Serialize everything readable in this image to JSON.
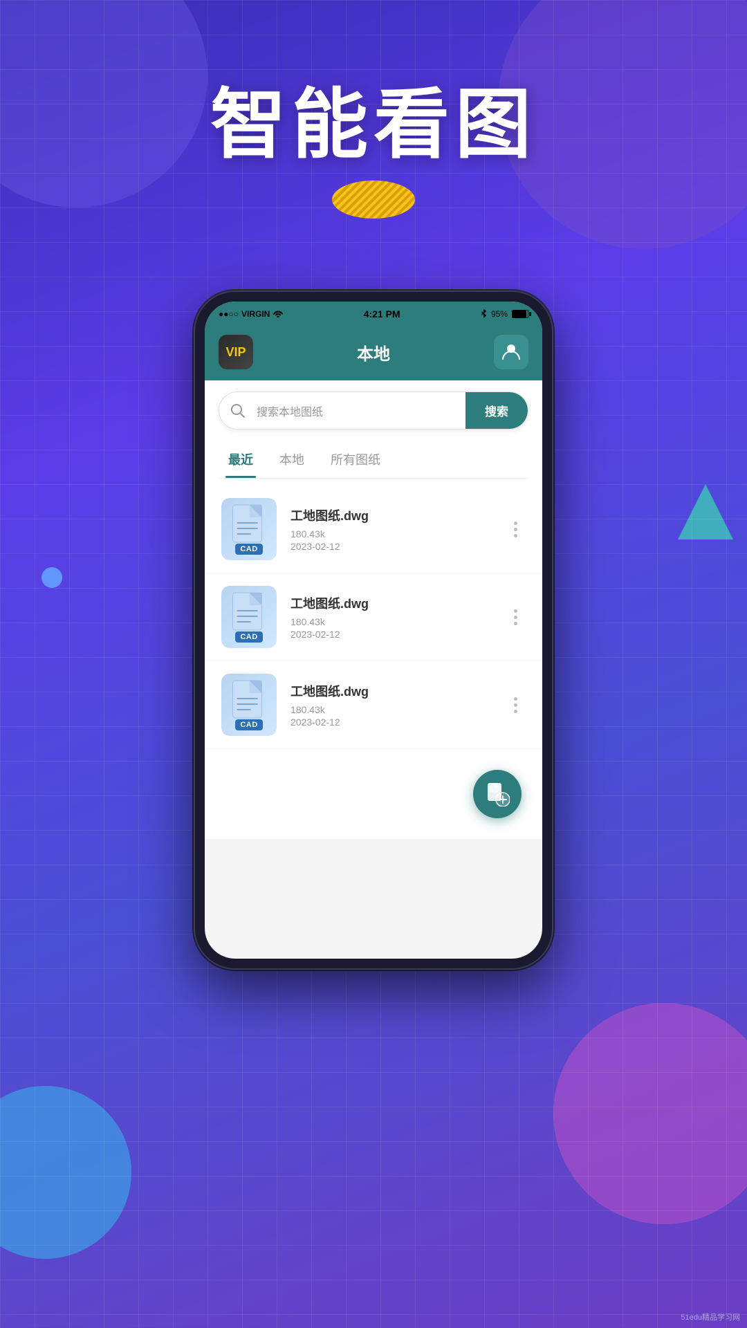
{
  "background": {
    "gradient_start": "#3a2db5",
    "gradient_end": "#6b3ec4"
  },
  "header": {
    "title": "智能看图",
    "subtitle_decoration": "gold_ellipse"
  },
  "statusBar": {
    "carrier": "VIRGIN",
    "time": "4:21 PM",
    "battery": "95%",
    "wifi": true,
    "bluetooth": true
  },
  "appHeader": {
    "vip_label": "VIP",
    "page_title": "本地",
    "user_icon": "person-icon"
  },
  "search": {
    "placeholder": "搜索本地图纸",
    "button_label": "搜索"
  },
  "tabs": [
    {
      "id": "recent",
      "label": "最近",
      "active": true
    },
    {
      "id": "local",
      "label": "本地",
      "active": false
    },
    {
      "id": "all",
      "label": "所有图纸",
      "active": false
    }
  ],
  "files": [
    {
      "name": "工地图纸.dwg",
      "size": "180.43k",
      "date": "2023-02-12",
      "type": "CAD"
    },
    {
      "name": "工地图纸.dwg",
      "size": "180.43k",
      "date": "2023-02-12",
      "type": "CAD"
    },
    {
      "name": "工地图纸.dwg",
      "size": "180.43k",
      "date": "2023-02-12",
      "type": "CAD"
    }
  ],
  "fab": {
    "icon": "add-file-icon",
    "label": "添加文件"
  },
  "watermark": "51edu精品学习网"
}
